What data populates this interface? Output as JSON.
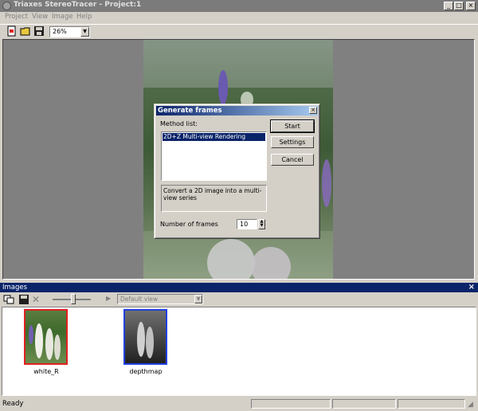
{
  "window": {
    "title": "Triaxes StereoTracer - Project:1"
  },
  "menu": [
    "Project",
    "View",
    "Image",
    "Help"
  ],
  "toolbar": {
    "zoom_value": "26%"
  },
  "dialog": {
    "title": "Generate frames",
    "method_list_label": "Method list:",
    "methods": [
      "2D+Z Multi-view Rendering"
    ],
    "description": "Convert a 2D image into a multi-view series",
    "buttons": {
      "start": "Start",
      "settings": "Settings",
      "cancel": "Cancel"
    },
    "frames_label": "Number of frames",
    "frames_value": "10"
  },
  "images_panel": {
    "title": "Images",
    "view_select": "Default view",
    "thumbnails": [
      {
        "label": "white_R"
      },
      {
        "label": "depthmap"
      }
    ]
  },
  "status": {
    "text": "Ready"
  }
}
